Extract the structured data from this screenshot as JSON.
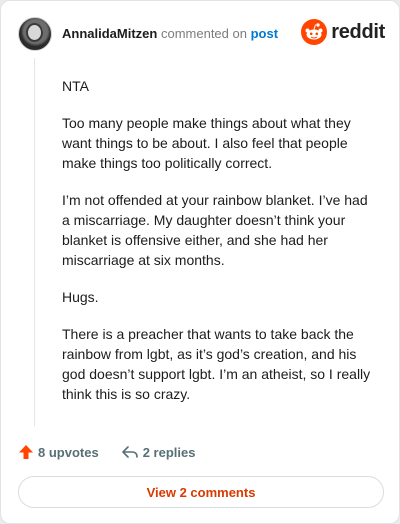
{
  "header": {
    "username": "AnnalidaMitzen",
    "action_text": "commented on",
    "post_link": "post",
    "logo_text": "reddit"
  },
  "comment": {
    "paragraphs": [
      "NTA",
      "Too many people make things about what they want things to be about. I also feel that people make things too politically correct.",
      "I’m not offended at your rainbow blanket. I’ve had a miscarriage. My daughter doesn’t think your blanket is offensive either, and she had her miscarriage at six months.",
      "Hugs.",
      "There is a preacher that wants to take back the rainbow from lgbt, as it’s god’s creation, and his god doesn’t support lgbt. I’m an atheist, so I really think this is so crazy."
    ]
  },
  "actions": {
    "upvotes": "8 upvotes",
    "replies": "2 replies"
  },
  "footer": {
    "view_comments_label": "View 2 comments"
  },
  "icons": {
    "upvote": "upvote-arrow-icon",
    "reply": "reply-arrow-icon",
    "logo": "reddit-snoo-icon"
  },
  "colors": {
    "upvote": "#ff4500",
    "link": "#0079d3",
    "view_button_text": "#d93a00",
    "brand": "#ff4500"
  }
}
